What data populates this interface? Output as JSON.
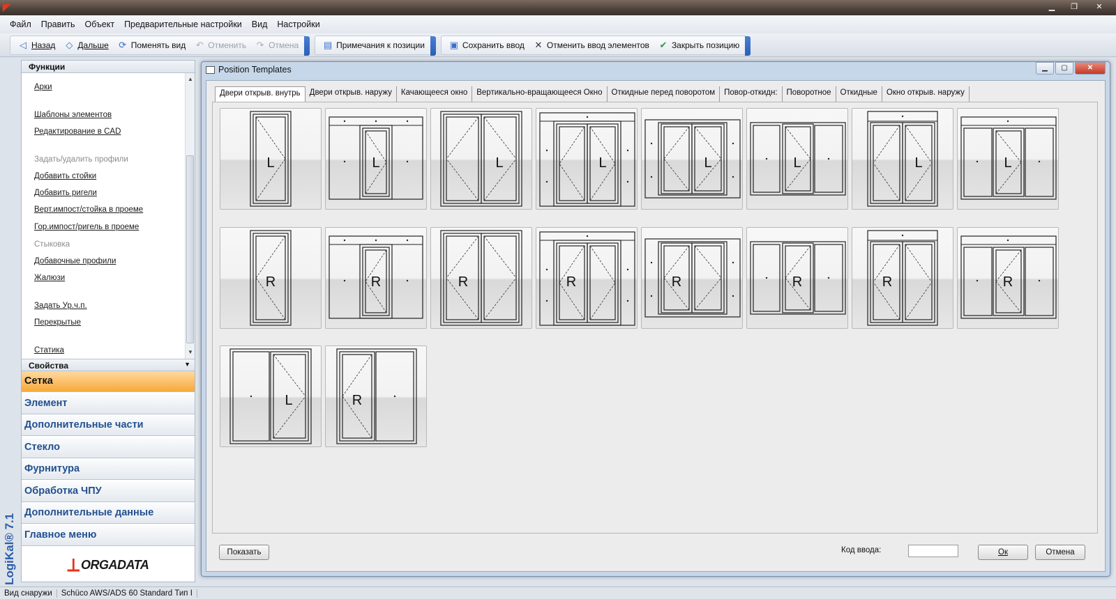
{
  "menu": [
    "Файл",
    "Править",
    "Объект",
    "Предварительные настройки",
    "Вид",
    "Настройки"
  ],
  "toolbar": {
    "back": "Назад",
    "forward": "Дальше",
    "change_view": "Поменять вид",
    "undo": "Отменить",
    "redo": "Отмена",
    "notes": "Примечания к позиции",
    "save": "Сохранить ввод",
    "cancel_input": "Отменить ввод элементов",
    "close_position": "Закрыть позицию"
  },
  "left": {
    "functions_title": "Функции",
    "items": [
      {
        "label": "Арки",
        "enabled": true
      },
      {
        "label": "Шаблоны элементов",
        "enabled": true
      },
      {
        "label": "Редактирование в CAD",
        "enabled": true
      },
      {
        "label": "Задать/удалить профили",
        "enabled": false
      },
      {
        "label": "Добавить стойки",
        "enabled": true
      },
      {
        "label": "Добавить ригели",
        "enabled": true
      },
      {
        "label": "Верт.импост/стойка в проеме",
        "enabled": true
      },
      {
        "label": "Гор.импост/ригель в проеме",
        "enabled": true
      },
      {
        "label": "Стыковка",
        "enabled": false
      },
      {
        "label": "Добавочные профили",
        "enabled": true
      },
      {
        "label": "Жалюзи",
        "enabled": true
      },
      {
        "label": "Задать Ур.ч.п.",
        "enabled": true
      },
      {
        "label": "Перекрытые",
        "enabled": true
      },
      {
        "label": "Статика",
        "enabled": true
      }
    ],
    "properties_title": "Свойства",
    "nav": [
      "Сетка",
      "Элемент",
      "Дополнительные части",
      "Стекло",
      "Фурнитура",
      "Обработка ЧПУ",
      "Дополнительные данные",
      "Главное меню"
    ],
    "active_nav": "Сетка",
    "logo_text": "ORGADATA",
    "app_label": "LogiKal® 7.1"
  },
  "dialog": {
    "title": "Position Templates",
    "tabs": [
      "Двери открыв. внутрь",
      "Двери открыв. наружу",
      "Качающееся окно",
      "Вертикально-вращающееся Окно",
      "Откидные перед поворотом",
      "Повор-откидн:",
      "Поворотное",
      "Откидные",
      "Окно открыв. наружу"
    ],
    "active_tab": "Двери открыв. внутрь",
    "templates": [
      {
        "id": "t1",
        "label": "L"
      },
      {
        "id": "t2",
        "label": "L"
      },
      {
        "id": "t3",
        "label": "L"
      },
      {
        "id": "t4",
        "label": "L"
      },
      {
        "id": "t5",
        "label": "L"
      },
      {
        "id": "t6",
        "label": "L"
      },
      {
        "id": "t7",
        "label": "L"
      },
      {
        "id": "t8",
        "label": "L"
      },
      {
        "id": "t9",
        "label": "R"
      },
      {
        "id": "t10",
        "label": "R"
      },
      {
        "id": "t11",
        "label": "R"
      },
      {
        "id": "t12",
        "label": "R"
      },
      {
        "id": "t13",
        "label": "R"
      },
      {
        "id": "t14",
        "label": "R"
      },
      {
        "id": "t15",
        "label": "R"
      },
      {
        "id": "t16",
        "label": "R"
      },
      {
        "id": "t17",
        "label": "L"
      },
      {
        "id": "t18",
        "label": "R"
      }
    ],
    "show_button": "Показать",
    "code_label": "Код ввода:",
    "code_value": "",
    "ok_button": "Ок",
    "cancel_button": "Отмена"
  },
  "status": {
    "view": "Вид снаружи",
    "system": "Schüco AWS/ADS 60 Standard Тип I"
  }
}
